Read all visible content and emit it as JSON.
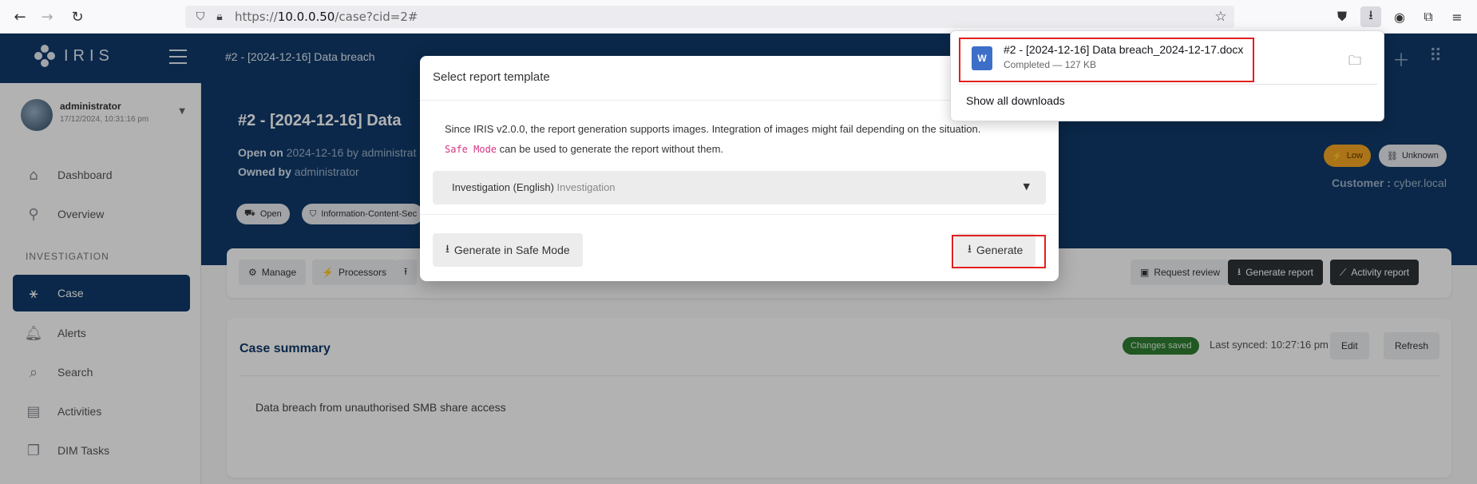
{
  "browser": {
    "url_prefix": "https://",
    "url_host": "10.0.0.50",
    "url_path": "/case?cid=2#"
  },
  "app": {
    "logo_text": "IRIS",
    "header_title": "#2 - [2024-12-16] Data breach"
  },
  "user": {
    "name": "administrator",
    "last_login": "17/12/2024, 10:31:16 pm"
  },
  "sidebar": {
    "items_top": [
      {
        "label": "Dashboard",
        "icon": "home-icon"
      },
      {
        "label": "Overview",
        "icon": "pin-icon"
      }
    ],
    "section_label": "INVESTIGATION",
    "items_investigation": [
      {
        "label": "Case",
        "icon": "network-icon"
      },
      {
        "label": "Alerts",
        "icon": "bell-icon"
      },
      {
        "label": "Search",
        "icon": "search-icon"
      },
      {
        "label": "Activities",
        "icon": "document-icon"
      },
      {
        "label": "DIM Tasks",
        "icon": "tasks-icon"
      }
    ]
  },
  "case": {
    "title": "#2 - [2024-12-16] Data",
    "open_label": "Open on",
    "open_date": "2024-12-16",
    "open_by": "by administrat",
    "owned_label": "Owned by",
    "owner": "administrator",
    "status_chip": "Open",
    "classification_chip": "Information-Content-Sec",
    "severity": "Low",
    "outcome": "Unknown",
    "customer_label": "Customer :",
    "customer": "cyber.local"
  },
  "toolbar": {
    "manage": "Manage",
    "processors": "Processors",
    "request_review": "Request review",
    "generate_report": "Generate report",
    "activity_report": "Activity report"
  },
  "summary": {
    "title": "Case summary",
    "saved_badge": "Changes saved",
    "last_synced": "Last synced: 10:27:16 pm",
    "edit": "Edit",
    "refresh": "Refresh",
    "text": "Data breach from unauthorised SMB share access"
  },
  "modal": {
    "title": "Select report template",
    "info_line1": "Since IRIS v2.0.0, the report generation supports images. Integration of images might fail depending on the situation.",
    "safe_mode_code": "Safe Mode",
    "info_line2_rest": " can be used to generate the report without them.",
    "selected_template": "Investigation (English)",
    "selected_template_type": "Investigation",
    "generate_safe_label": "Generate in Safe Mode",
    "generate_label": "Generate"
  },
  "downloads": {
    "file_name": "#2 - [2024-12-16] Data breach_2024-12-17.docx",
    "status": "Completed — 127 KB",
    "show_all": "Show all downloads",
    "file_icon_letter": "W"
  },
  "colors": {
    "brand": "#103a6a",
    "highlight": "#e0201e",
    "severity_low": "#f5a623",
    "saved_green": "#2e7d32"
  }
}
